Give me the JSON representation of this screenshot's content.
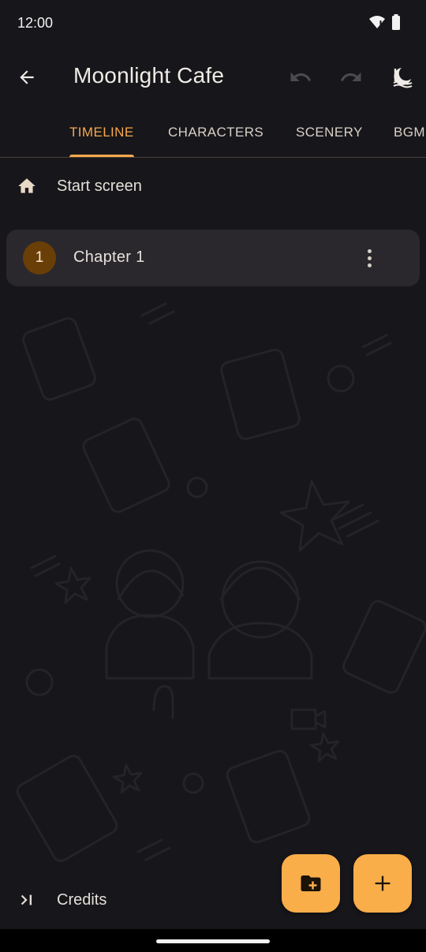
{
  "status_bar": {
    "time": "12:00",
    "icons": [
      "wifi-icon",
      "battery-icon"
    ]
  },
  "app_bar": {
    "title": "Moonlight Cafe",
    "icons": [
      "arrow-back-icon",
      "undo-icon",
      "redo-icon",
      "theme-icon"
    ]
  },
  "tabs": {
    "items": [
      {
        "label": "TIMELINE",
        "active": true
      },
      {
        "label": "CHARACTERS",
        "active": false
      },
      {
        "label": "SCENERY",
        "active": false
      },
      {
        "label": "BGM",
        "active": false
      }
    ]
  },
  "timeline": {
    "start_label": "Start screen",
    "start_icon": "home-icon",
    "chapters": [
      {
        "number": "1",
        "title": "Chapter 1",
        "menu_icon": "more-vert-icon"
      }
    ],
    "credits_label": "Credits",
    "credits_icon": "skip-to-end-icon"
  },
  "fabs": {
    "add_folder_icon": "create-new-folder-icon",
    "add_icon": "add-icon"
  },
  "colors": {
    "background": "#17161a",
    "accent": "#f7a84c",
    "fab": "#f9ae4a",
    "card": "#2a282d",
    "badge": "#6a3e07"
  }
}
